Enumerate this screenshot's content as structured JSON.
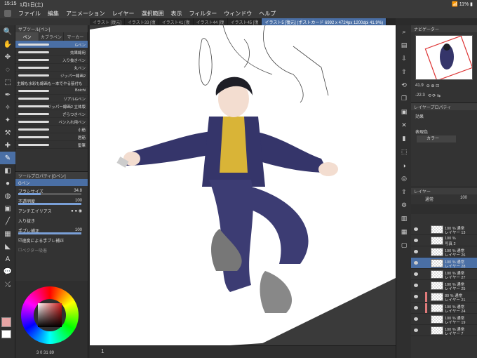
{
  "status": {
    "time": "15:15",
    "date": "1月1日(土)",
    "battery": "11%"
  },
  "menu": [
    "ファイル",
    "編集",
    "アニメーション",
    "レイヤー",
    "選択範囲",
    "表示",
    "フィルター",
    "ウィンドウ",
    "ヘルプ"
  ],
  "doc_tabs": [
    {
      "label": "イラスト [復元]",
      "active": false
    },
    {
      "label": "イラスト33 [復",
      "active": false
    },
    {
      "label": "イラスト41 [復",
      "active": false
    },
    {
      "label": "イラスト44 [復",
      "active": false
    },
    {
      "label": "イラスト45 [復",
      "active": false
    },
    {
      "label": "イラスト5 [復元] (ポストカード 6992 x 4724px 1200dpi 41.9%)",
      "active": true
    }
  ],
  "subtool": {
    "header": "サブツール[ペン]",
    "tabs": [
      "ペン",
      "カブラペン",
      "マーカー"
    ],
    "brushes": [
      "Gペン",
      "効果線用",
      "入り抜きペン",
      "丸ペン",
      "ジッパー線画2",
      "主線も水彩も線画もー本でやる筋付も",
      "Boichi",
      "リアルGペン",
      "ジッパー線画2 立体版",
      "ざらつきペン",
      "ペン入れ用ペン",
      "小筋",
      "唇筋",
      "髪筆"
    ]
  },
  "toolprop": {
    "header": "ツールプロパティ[Gペン]",
    "tool_name": "Gペン",
    "brush_size_label": "ブラシサイズ",
    "brush_size": "34.8",
    "opacity_label": "不透明度",
    "opacity": "100",
    "antialias_label": "アンチエイリアス",
    "wetness_label": "入り抜き",
    "stabilizer_label": "手ブレ補正",
    "stabilizer": "100",
    "speed_label": "速度による手ブレ補正",
    "vector_label": "ベクター吸着"
  },
  "color": {
    "main": "#e8a5a5",
    "info": "3 0 31 89"
  },
  "navigator": {
    "header": "ナビゲーター",
    "zoom": "41.9",
    "angle": "-22.3"
  },
  "layerprop": {
    "header": "レイヤープロパティ",
    "effect_label": "効果",
    "expression_label": "表現色",
    "expression_value": "カラー"
  },
  "layer_panel": {
    "header": "レイヤー",
    "blend_mode": "通常",
    "opacity": "100",
    "layers": [
      {
        "l1": "100 % 通常",
        "l2": "レイヤー 13"
      },
      {
        "l1": "100 %",
        "l2": "写真 2"
      },
      {
        "l1": "100 % 通常",
        "l2": "レイヤー 26"
      },
      {
        "l1": "100 % 通常",
        "l2": "レイヤー 28"
      },
      {
        "l1": "100 % 通常",
        "l2": "レイヤー 27"
      },
      {
        "l1": "100 % 通常",
        "l2": "レイヤー 25"
      },
      {
        "l1": "80 % 通常",
        "l2": "レイヤー 21"
      },
      {
        "l1": "100 % 通常",
        "l2": "レイヤー 24"
      },
      {
        "l1": "100 % 通常",
        "l2": "レイヤー 19"
      },
      {
        "l1": "100 % 通常",
        "l2": "レイヤー 7"
      }
    ]
  },
  "page_number": "1"
}
